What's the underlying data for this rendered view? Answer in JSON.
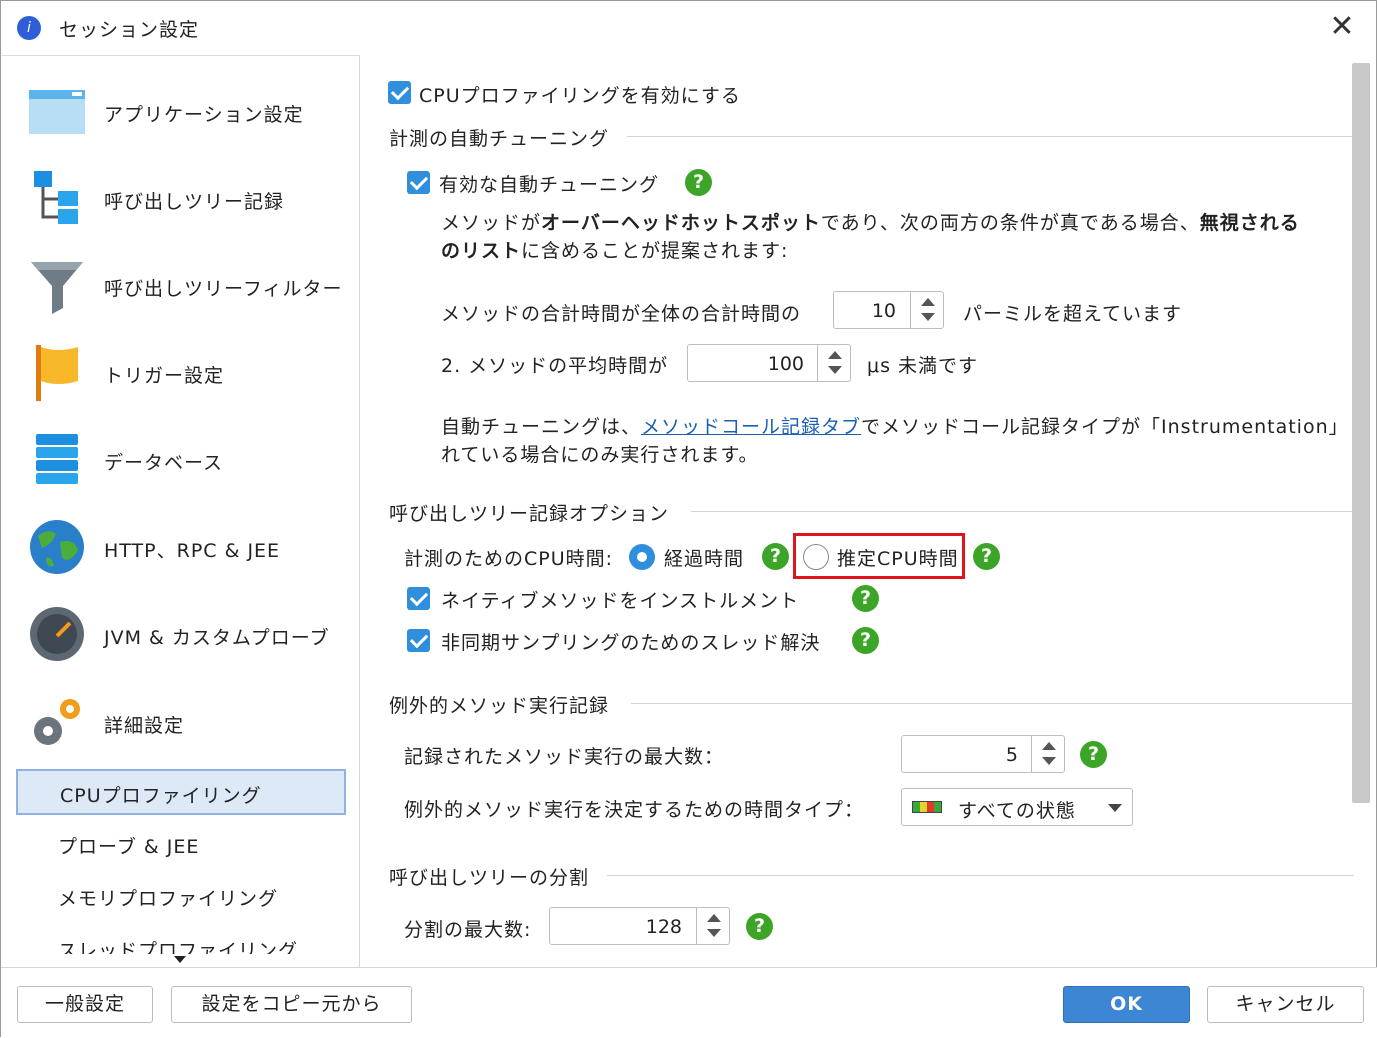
{
  "window": {
    "title": "セッション設定",
    "close_glyph": "✕"
  },
  "sidebar": {
    "categories": [
      {
        "label": "アプリケーション設定",
        "icon": "application-window-icon"
      },
      {
        "label": "呼び出しツリー記録",
        "icon": "call-tree-icon"
      },
      {
        "label": "呼び出しツリーフィルター",
        "icon": "funnel-icon"
      },
      {
        "label": "トリガー設定",
        "icon": "flag-icon"
      },
      {
        "label": "データベース",
        "icon": "database-icon"
      },
      {
        "label": "HTTP、RPC & JEE",
        "icon": "globe-icon"
      },
      {
        "label": "JVM & カスタムプローブ",
        "icon": "gauge-icon"
      },
      {
        "label": "詳細設定",
        "icon": "gears-icon"
      }
    ],
    "subitems": [
      {
        "label": "CPUプロファイリング",
        "selected": true
      },
      {
        "label": "プローブ & JEE",
        "selected": false
      },
      {
        "label": "メモリプロファイリング",
        "selected": false
      },
      {
        "label": "スレッドプロファイリング",
        "selected": false
      }
    ]
  },
  "main": {
    "enable_cpu": "CPUプロファイリングを有効にする",
    "auto_tuning": {
      "section": "計測の自動チューニング",
      "enabled_label": "有効な自動チューニング",
      "desc1_a": "メソッドが",
      "desc1_b": "オーバーヘッドホットスポット",
      "desc1_c": "であり、次の両方の条件が真である場合、",
      "desc1_d": "無視される",
      "desc2_a": "のリスト",
      "desc2_b": "に含めることが提案されます:",
      "cond1_label": "メソッドの合計時間が全体の合計時間の",
      "cond1_value": "10",
      "cond1_suffix": "パーミルを超えています",
      "cond2_label": "2. メソッドの平均時間が",
      "cond2_value": "100",
      "cond2_suffix": "μs 未満です",
      "note1_a": "自動チューニングは、",
      "note1_link": "メソッドコール記録タブ",
      "note1_b": "でメソッドコール記録タイプが「Instrumentation」",
      "note2": "れている場合にのみ実行されます。"
    },
    "call_tree": {
      "section": "呼び出しツリー記録オプション",
      "cpu_time_label": "計測のためのCPU時間:",
      "radio_elapsed": "経過時間",
      "radio_estimated": "推定CPU時間",
      "native_label": "ネイティブメソッドをインストルメント",
      "async_label": "非同期サンプリングのためのスレッド解決"
    },
    "exceptional": {
      "section": "例外的メソッド実行記録",
      "max_label": "記録されたメソッド実行の最大数：",
      "max_value": "5",
      "type_label": "例外的メソッド実行を決定するための時間タイプ：",
      "type_value": "すべての状態"
    },
    "split": {
      "section": "呼び出しツリーの分割",
      "max_label": "分割の最大数:",
      "max_value": "128"
    },
    "help_glyph": "?"
  },
  "footer": {
    "general": "一般設定",
    "copy": "設定をコピー元から",
    "ok": "OK",
    "cancel": "キャンセル"
  },
  "colors": {
    "accent": "#2f8fdd",
    "help": "#3ca427",
    "highlight": "#e0141c",
    "ok": "#3d86d3"
  }
}
